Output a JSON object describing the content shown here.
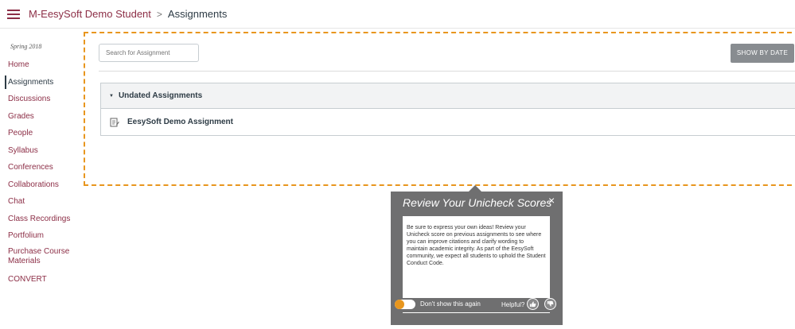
{
  "header": {
    "menu_icon": "hamburger-icon",
    "course_name": "M-EesySoft Demo Student",
    "separator": ">",
    "current_page": "Assignments"
  },
  "sidebar": {
    "term": "Spring 2018",
    "items": [
      {
        "label": "Home"
      },
      {
        "label": "Assignments",
        "active": true
      },
      {
        "label": "Discussions"
      },
      {
        "label": "Grades"
      },
      {
        "label": "People"
      },
      {
        "label": "Syllabus"
      },
      {
        "label": "Conferences"
      },
      {
        "label": "Collaborations"
      },
      {
        "label": "Chat"
      },
      {
        "label": "Class Recordings"
      },
      {
        "label": "Portfolium"
      },
      {
        "label": "Purchase Course Materials"
      },
      {
        "label": "CONVERT"
      }
    ]
  },
  "main": {
    "search_placeholder": "Search for Assignment",
    "show_by_date_label": "SHOW BY DATE",
    "group": {
      "title": "Undated Assignments",
      "assignments": [
        {
          "title": "EesySoft Demo Assignment",
          "icon": "assignment-icon"
        }
      ]
    }
  },
  "popup": {
    "title": "Review Your Unicheck Scores",
    "body": "Be sure to express your own ideas! Review your Unicheck score on previous assignments to see where you can improve citations and clarify wording to maintain academic integrity. As part of the EesySoft community, we expect all students to uphold the Student Conduct Code.",
    "dont_show_label": "Don't show this again",
    "helpful_label": "Helpful?",
    "close_symbol": "×"
  },
  "colors": {
    "link": "#8c2e46",
    "text": "#2d3b45",
    "accent_orange": "#e8961e",
    "button_gray": "#888c90",
    "popup_bg": "#6f6f70"
  }
}
